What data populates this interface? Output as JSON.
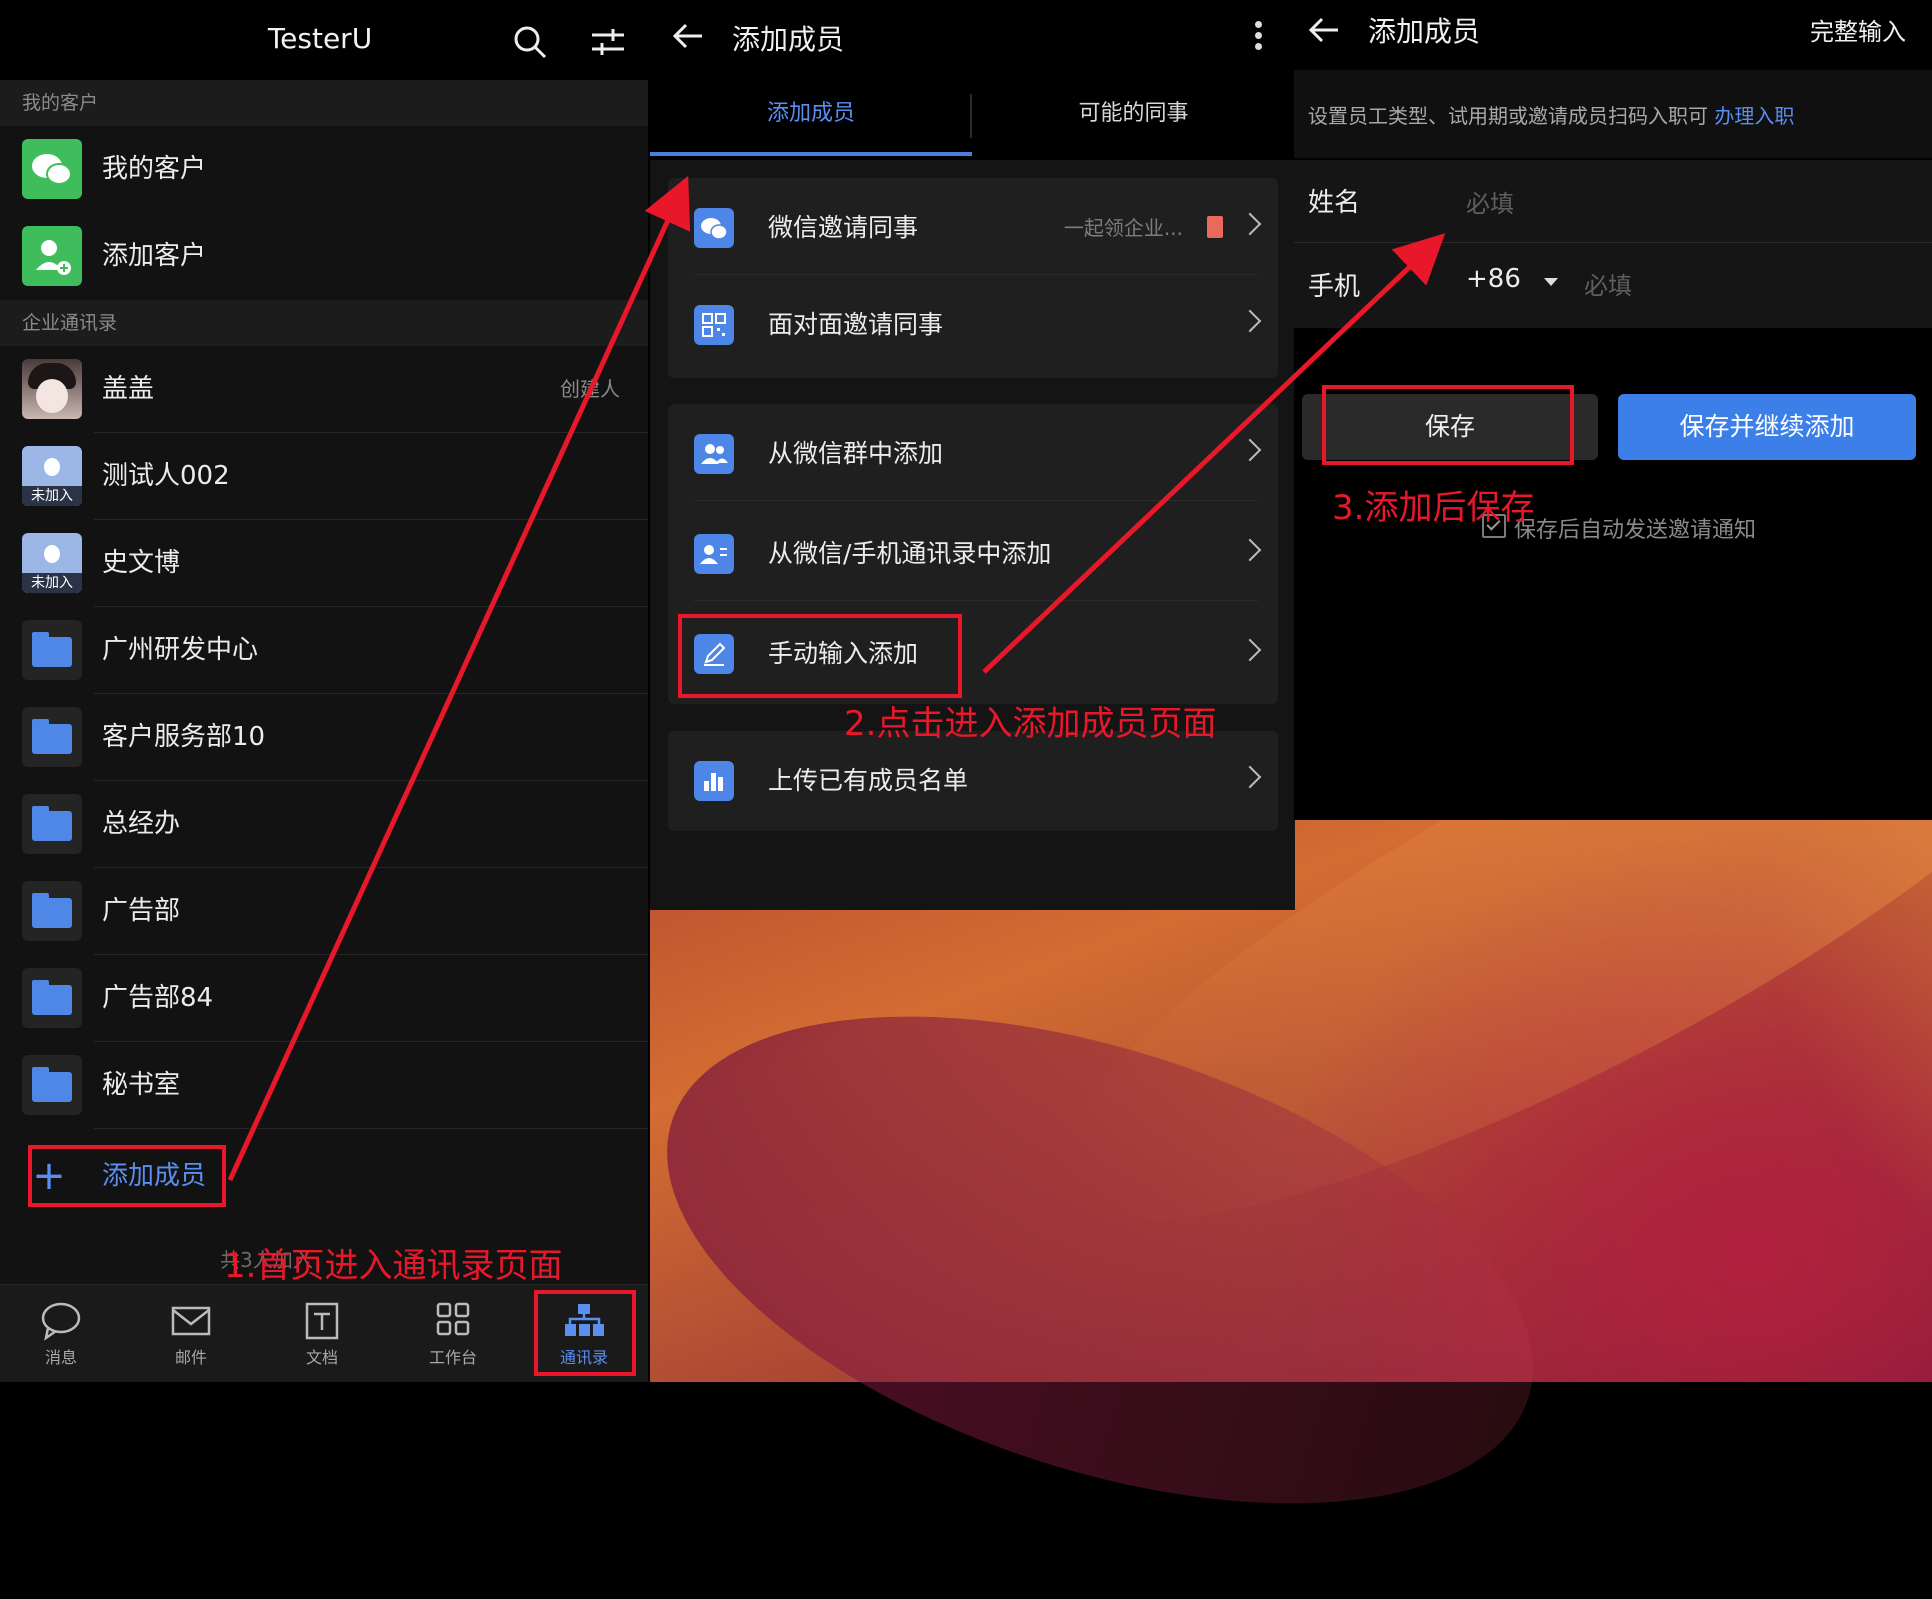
{
  "contacts": {
    "title": "TesterU",
    "section_customers": "我的客户",
    "customers": [
      {
        "label": "我的客户",
        "icon": "wechat-icon"
      },
      {
        "label": "添加客户",
        "icon": "add-contact-icon"
      }
    ],
    "section_directory": "企业通讯录",
    "members": [
      {
        "label": "盖盖",
        "tag": "创建人",
        "icon": "avatar"
      },
      {
        "label": "测试人002",
        "badge": "未加入",
        "icon": "person-icon"
      },
      {
        "label": "史文博",
        "badge": "未加入",
        "icon": "person-icon"
      }
    ],
    "folders": [
      {
        "label": "广州研发中心"
      },
      {
        "label": "客户服务部10"
      },
      {
        "label": "总经办"
      },
      {
        "label": "广告部"
      },
      {
        "label": "广告部84"
      },
      {
        "label": "秘书室"
      }
    ],
    "add_member": "添加成员",
    "hint": "共3人加入",
    "tabs": [
      {
        "label": "消息",
        "icon": "chat-bubble-icon"
      },
      {
        "label": "邮件",
        "icon": "mail-icon"
      },
      {
        "label": "文档",
        "icon": "document-icon"
      },
      {
        "label": "工作台",
        "icon": "grid-icon"
      },
      {
        "label": "通讯录",
        "icon": "org-chart-icon",
        "active": true
      }
    ]
  },
  "add_member": {
    "title": "添加成员",
    "tabs": [
      {
        "label": "添加成员",
        "active": true
      },
      {
        "label": "可能的同事"
      }
    ],
    "group1": [
      {
        "label": "微信邀请同事",
        "extra": "一起领企业...",
        "icon": "wechat-icon"
      },
      {
        "label": "面对面邀请同事",
        "icon": "qr-code-icon"
      }
    ],
    "group2": [
      {
        "label": "从微信群中添加",
        "icon": "group-icon"
      },
      {
        "label": "从微信/手机通讯录中添加",
        "icon": "contact-card-icon"
      },
      {
        "label": "手动输入添加",
        "icon": "edit-icon"
      }
    ],
    "group3": [
      {
        "label": "上传已有成员名单",
        "icon": "upload-chart-icon"
      }
    ]
  },
  "manual_entry": {
    "title": "添加成员",
    "full_input": "完整输入",
    "desc": "设置员工类型、试用期或邀请成员扫码入职可",
    "desc_link": "办理入职",
    "name_label": "姓名",
    "name_placeholder": "必填",
    "phone_label": "手机",
    "country_code": "+86",
    "phone_placeholder": "必填",
    "save": "保存",
    "save_continue": "保存并继续添加",
    "notify": "保存后自动发送邀请通知"
  },
  "annotations": {
    "step1": "1.首页进入通讯录页面",
    "step2": "2.点击进入添加成员页面",
    "step3": "3.添加后保存"
  },
  "colors": {
    "accent": "#5a8ef0",
    "annotation_red": "#e8182a",
    "primary_button": "#3d7fe8"
  }
}
